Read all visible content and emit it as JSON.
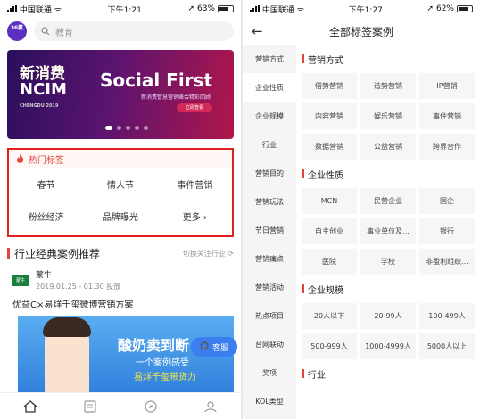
{
  "left": {
    "status": {
      "carrier": "中国联通",
      "time": "下午1:21",
      "battery": "63%",
      "battery_level": 0.63
    },
    "header": {
      "logo_text": "36氪",
      "search_placeholder": "教育"
    },
    "banner": {
      "line1": "新消费",
      "line2": "NCIM",
      "line3": "CHENGDU 2019",
      "title": "Social First",
      "subtitle": "新消费智慧营销峰会精彩回顾",
      "button": "立即查看"
    },
    "hot_tags": {
      "title": "热门标签",
      "tags": [
        "春节",
        "情人节",
        "事件营销",
        "粉丝经济",
        "品牌曝光",
        "更多 ›"
      ]
    },
    "section": {
      "title": "行业经典案例推荐",
      "switch_label": "切换关注行业"
    },
    "case": {
      "brand": "蒙牛",
      "brand_logo": "蒙牛",
      "date": "2019.01.25 - 01.30 投放",
      "title": "优益C×易烊千玺微博营销方案",
      "img_line1": "酸奶卖到断",
      "img_line2": "一个案例感受",
      "img_line3": "易烊千玺带货力"
    },
    "service_label": "客服",
    "tabs": [
      "home-icon",
      "list-icon",
      "compass-icon",
      "user-icon"
    ]
  },
  "right": {
    "status": {
      "carrier": "中国联通",
      "time": "下午1:27",
      "battery": "62%",
      "battery_level": 0.62
    },
    "nav": {
      "back": "←",
      "title": "全部标签案例"
    },
    "sidebar": [
      "营销方式",
      "企业性质",
      "企业规模",
      "行业",
      "营销目的",
      "营销玩法",
      "节日营销",
      "营销痛点",
      "营销活动",
      "热点项目",
      "台网联动",
      "奖项",
      "KOL类型"
    ],
    "groups": [
      {
        "title": "营销方式",
        "tags": [
          "借势营销",
          "造势营销",
          "IP营销",
          "内容营销",
          "娱乐营销",
          "事件营销",
          "数据营销",
          "公益营销",
          "跨界合作"
        ]
      },
      {
        "title": "企业性质",
        "tags": [
          "MCN",
          "民营企业",
          "国企",
          "自主创业",
          "事业单位及...",
          "银行",
          "医院",
          "学校",
          "非盈利组织..."
        ]
      },
      {
        "title": "企业规模",
        "tags": [
          "20人以下",
          "20-99人",
          "100-499人",
          "500-999人",
          "1000-4999人",
          "5000人以上"
        ]
      },
      {
        "title": "行业",
        "tags": []
      }
    ]
  }
}
